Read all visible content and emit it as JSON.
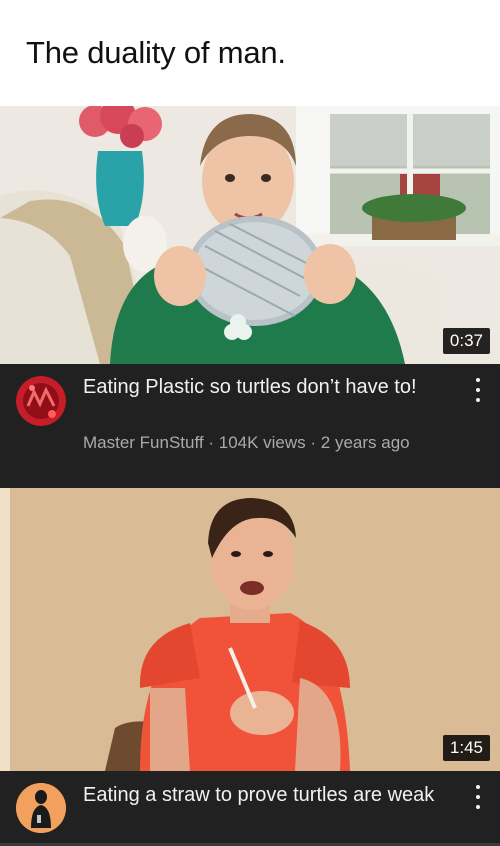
{
  "caption": "The duality of man.",
  "videos": [
    {
      "title": "Eating Plastic so turtles don’t have to!",
      "channel": "Master FunStuff",
      "views": "104K views",
      "age": "2 years ago",
      "sub_line": "Master FunStuff · 104K views · 2 years ago",
      "duration": "0:37"
    },
    {
      "title": "Eating a straw to prove turtles are weak",
      "duration": "1:45"
    }
  ],
  "colors": {
    "meta_background": "#212121",
    "title_text": "#f1f1f1",
    "sub_text": "#aaaaaa"
  },
  "icons": [
    "more-vert-icon"
  ]
}
